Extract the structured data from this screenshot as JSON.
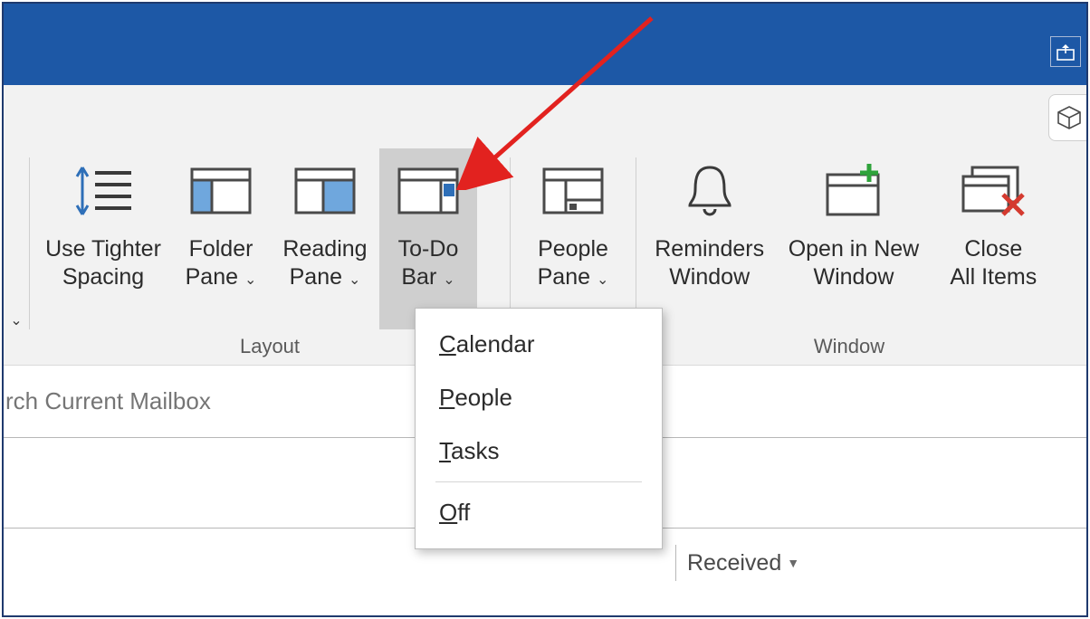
{
  "titlebar": {},
  "ribbon": {
    "groups": {
      "layout": {
        "label": "Layout",
        "buttons": {
          "use_tighter": {
            "line1": "Use Tighter",
            "line2": "Spacing"
          },
          "folder_pane": {
            "line1": "Folder",
            "line2": "Pane"
          },
          "reading_pane": {
            "line1": "Reading",
            "line2": "Pane"
          },
          "todo_bar": {
            "line1": "To-Do",
            "line2": "Bar"
          }
        }
      },
      "people": {
        "label": "",
        "buttons": {
          "people_pane": {
            "line1": "People",
            "line2": "Pane"
          }
        }
      },
      "window": {
        "label": "Window",
        "buttons": {
          "reminders": {
            "line1": "Reminders",
            "line2": "Window"
          },
          "open_new": {
            "line1": "Open in New",
            "line2": "Window"
          },
          "close_all": {
            "line1": "Close",
            "line2": "All Items"
          }
        }
      }
    }
  },
  "dropdown": {
    "calendar": "Calendar",
    "people": "People",
    "tasks": "Tasks",
    "off": "Off"
  },
  "search": {
    "placeholder": "rch Current Mailbox"
  },
  "sort": {
    "received": "Received"
  }
}
